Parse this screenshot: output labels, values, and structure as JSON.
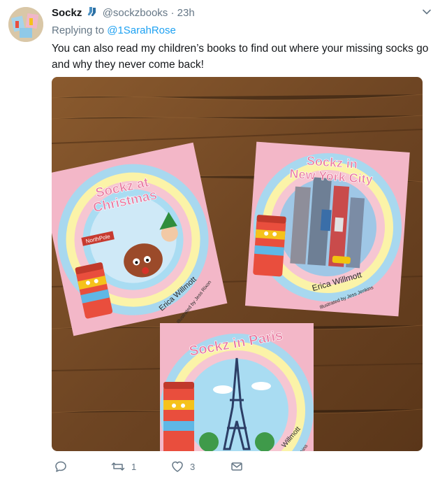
{
  "tweet": {
    "display_name": "Sockz",
    "handle": "@sockzbooks",
    "separator": "·",
    "time": "23h",
    "replying_prefix": "Replying to",
    "replying_to": "@1SarahRose",
    "text": "You can also read my children’s books to find out where your missing socks go and why they never come back!"
  },
  "media": {
    "books": [
      {
        "title_line1": "Sockz at",
        "title_line2": "Christmas",
        "author": "Erica Willmott",
        "illustrator": "Illustrated by Jess Rixon"
      },
      {
        "title_line1": "Sockz in",
        "title_line2": "New York City",
        "author": "Erica Willmott",
        "illustrator": "Illustrated by Jess Jenkins"
      },
      {
        "title_line1": "Sockz in Paris",
        "author": "Willmott",
        "illustrator": "Jenkins"
      }
    ],
    "sign_text": "NorthPole"
  },
  "actions": {
    "reply_count": "",
    "retweet_count": "1",
    "like_count": "3"
  },
  "colors": {
    "link": "#1da1f2",
    "secondary": "#657786",
    "text": "#14171a"
  }
}
